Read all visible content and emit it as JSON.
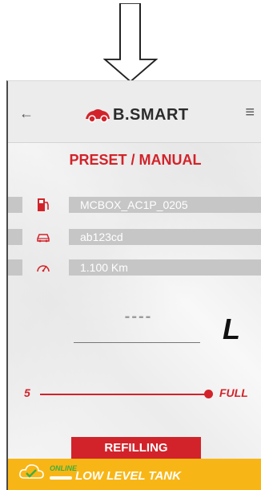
{
  "app": {
    "brand": "B.SMART"
  },
  "header": {
    "back_icon": "arrow-left-icon",
    "menu_icon": "hamburger-icon"
  },
  "page": {
    "title": "PRESET / MANUAL"
  },
  "info_rows": [
    {
      "icon": "fuel-pump-icon",
      "value": "MCBOX_AC1P_0205"
    },
    {
      "icon": "car-icon",
      "value": "ab123cd"
    },
    {
      "icon": "speedometer-icon",
      "value": "1.100 Km"
    }
  ],
  "quantity": {
    "display": "----",
    "unit": "L"
  },
  "slider": {
    "min_label": "5",
    "max_label": "FULL",
    "position_fraction": 1.0
  },
  "actions": {
    "refill_label": "REFILLING"
  },
  "status": {
    "connection": "ONLINE",
    "message": "LOW LEVEL TANK",
    "icon": "cloud-check-icon"
  },
  "colors": {
    "accent": "#d2232a",
    "banner": "#f8b616",
    "field": "#c6c6c6",
    "online": "#3fae3f"
  }
}
